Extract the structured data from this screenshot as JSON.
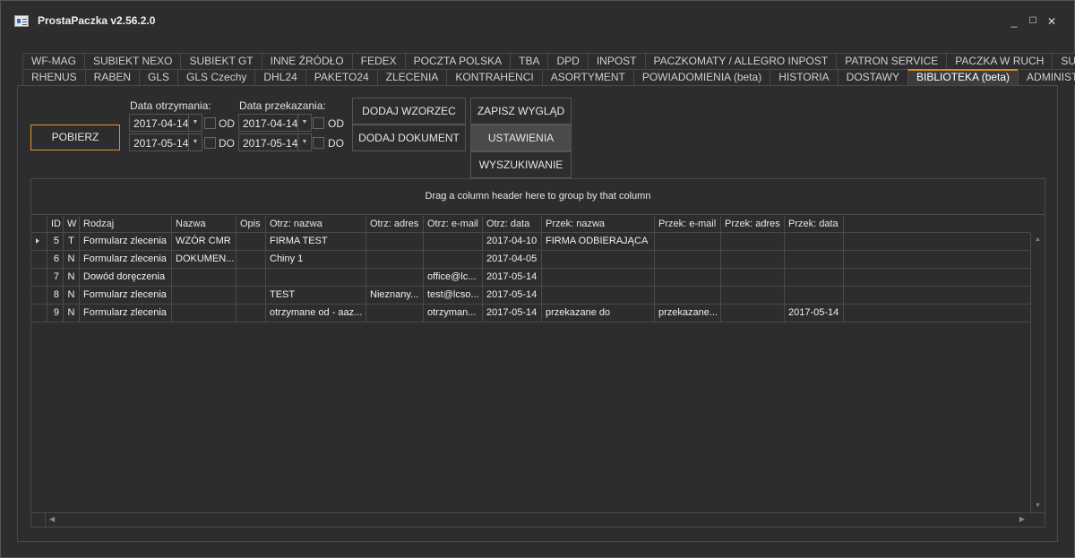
{
  "window": {
    "title": "ProstaPaczka v2.56.2.0",
    "min": "_",
    "max": "☐",
    "close": "✕"
  },
  "tabs_row1": [
    "WF-MAG",
    "SUBIEKT NEXO",
    "SUBIEKT GT",
    "INNE ŹRÓDŁO",
    "FEDEX",
    "POCZTA POLSKA",
    "TBA",
    "DPD",
    "INPOST",
    "PACZKOMATY / ALLEGRO INPOST",
    "PATRON SERVICE",
    "PACZKA W RUCH",
    "SUUS"
  ],
  "tabs_row2": [
    "RHENUS",
    "RABEN",
    "GLS",
    "GLS Czechy",
    "DHL24",
    "PAKETO24",
    "ZLECENIA",
    "KONTRAHENCI",
    "ASORTYMENT",
    "POWIADOMIENIA (beta)",
    "HISTORIA",
    "DOSTAWY",
    "BIBLIOTEKA (beta)",
    "ADMINISTRACJA"
  ],
  "active_tab": "BIBLIOTEKA (beta)",
  "toolbar": {
    "pobierz": "POBIERZ",
    "data_otrzymania_label": "Data otrzymania:",
    "data_przekazania_label": "Data przekazania:",
    "otrz_od": "2017-04-14",
    "otrz_do": "2017-05-14",
    "przek_od": "2017-04-14",
    "przek_do": "2017-05-14",
    "od": "OD",
    "do": "DO",
    "dodaj_wzorzec": "DODAJ WZORZEC",
    "dodaj_dokument": "DODAJ DOKUMENT",
    "zapisz_wyglad": "ZAPISZ WYGLĄD",
    "ustawienia": "USTAWIENIA",
    "wyszukiwanie": "WYSZUKIWANIE"
  },
  "grid": {
    "group_hint": "Drag a column header here to group by that column",
    "columns": [
      "ID",
      "W",
      "Rodzaj",
      "Nazwa",
      "Opis",
      "Otrz: nazwa",
      "Otrz: adres",
      "Otrz: e-mail",
      "Otrz: data",
      "Przek: nazwa",
      "Przek: e-mail",
      "Przek: adres",
      "Przek: data"
    ],
    "rows": [
      [
        "5",
        "T",
        "Formularz zlecenia",
        "WZÓR CMR",
        "",
        "FIRMA TEST",
        "",
        "",
        "2017-04-10",
        "FIRMA ODBIERAJĄCA",
        "",
        "",
        ""
      ],
      [
        "6",
        "N",
        "Formularz zlecenia",
        "DOKUMEN...",
        "",
        "Chiny 1",
        "",
        "",
        "2017-04-05",
        "",
        "",
        "",
        ""
      ],
      [
        "7",
        "N",
        "Dowód doręczenia",
        "",
        "",
        "",
        "",
        "office@lc...",
        "2017-05-14",
        "",
        "",
        "",
        ""
      ],
      [
        "8",
        "N",
        "Formularz zlecenia",
        "",
        "",
        "TEST",
        "Nieznany...",
        "test@lcso...",
        "2017-05-14",
        "",
        "",
        "",
        ""
      ],
      [
        "9",
        "N",
        "Formularz zlecenia",
        "",
        "",
        "otrzymane od - aaz...",
        "",
        "otrzyman...",
        "2017-05-14",
        "przekazane do",
        "przekazane...",
        "",
        "2017-05-14"
      ]
    ],
    "current_row": 0
  }
}
